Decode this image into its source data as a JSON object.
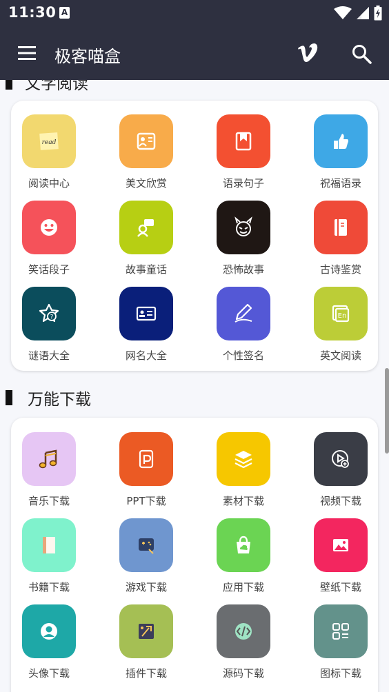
{
  "status": {
    "time": "11:30",
    "notif": "A"
  },
  "app_bar": {
    "title": "极客喵盒"
  },
  "section1": {
    "title": "文字阅读",
    "items": [
      {
        "label": "阅读中心",
        "color": "#f2d86f"
      },
      {
        "label": "美文欣赏",
        "color": "#f8ab4a"
      },
      {
        "label": "语录句子",
        "color": "#f35031"
      },
      {
        "label": "祝福语录",
        "color": "#3ea8e6"
      },
      {
        "label": "笑话段子",
        "color": "#f5525a"
      },
      {
        "label": "故事童话",
        "color": "#b7cf13"
      },
      {
        "label": "恐怖故事",
        "color": "#1f1714"
      },
      {
        "label": "古诗鉴赏",
        "color": "#ef4a38"
      },
      {
        "label": "谜语大全",
        "color": "#0b4d5c"
      },
      {
        "label": "网名大全",
        "color": "#0a1f7a"
      },
      {
        "label": "个性签名",
        "color": "#5458d6"
      },
      {
        "label": "英文阅读",
        "color": "#bccd37"
      }
    ]
  },
  "section2": {
    "title": "万能下载",
    "items": [
      {
        "label": "音乐下载",
        "color": "#e6c6f4"
      },
      {
        "label": "PPT下载",
        "color": "#eb5a24"
      },
      {
        "label": "素材下载",
        "color": "#f6c700"
      },
      {
        "label": "视频下载",
        "color": "#3a3d46"
      },
      {
        "label": "书籍下载",
        "color": "#7ff2cc"
      },
      {
        "label": "游戏下载",
        "color": "#6f96cf"
      },
      {
        "label": "应用下载",
        "color": "#6bd453"
      },
      {
        "label": "壁纸下载",
        "color": "#f3265f"
      },
      {
        "label": "头像下载",
        "color": "#1ea8a7"
      },
      {
        "label": "插件下载",
        "color": "#a5bf54"
      },
      {
        "label": "源码下载",
        "color": "#6a6d70"
      },
      {
        "label": "图标下载",
        "color": "#63928b"
      }
    ]
  }
}
